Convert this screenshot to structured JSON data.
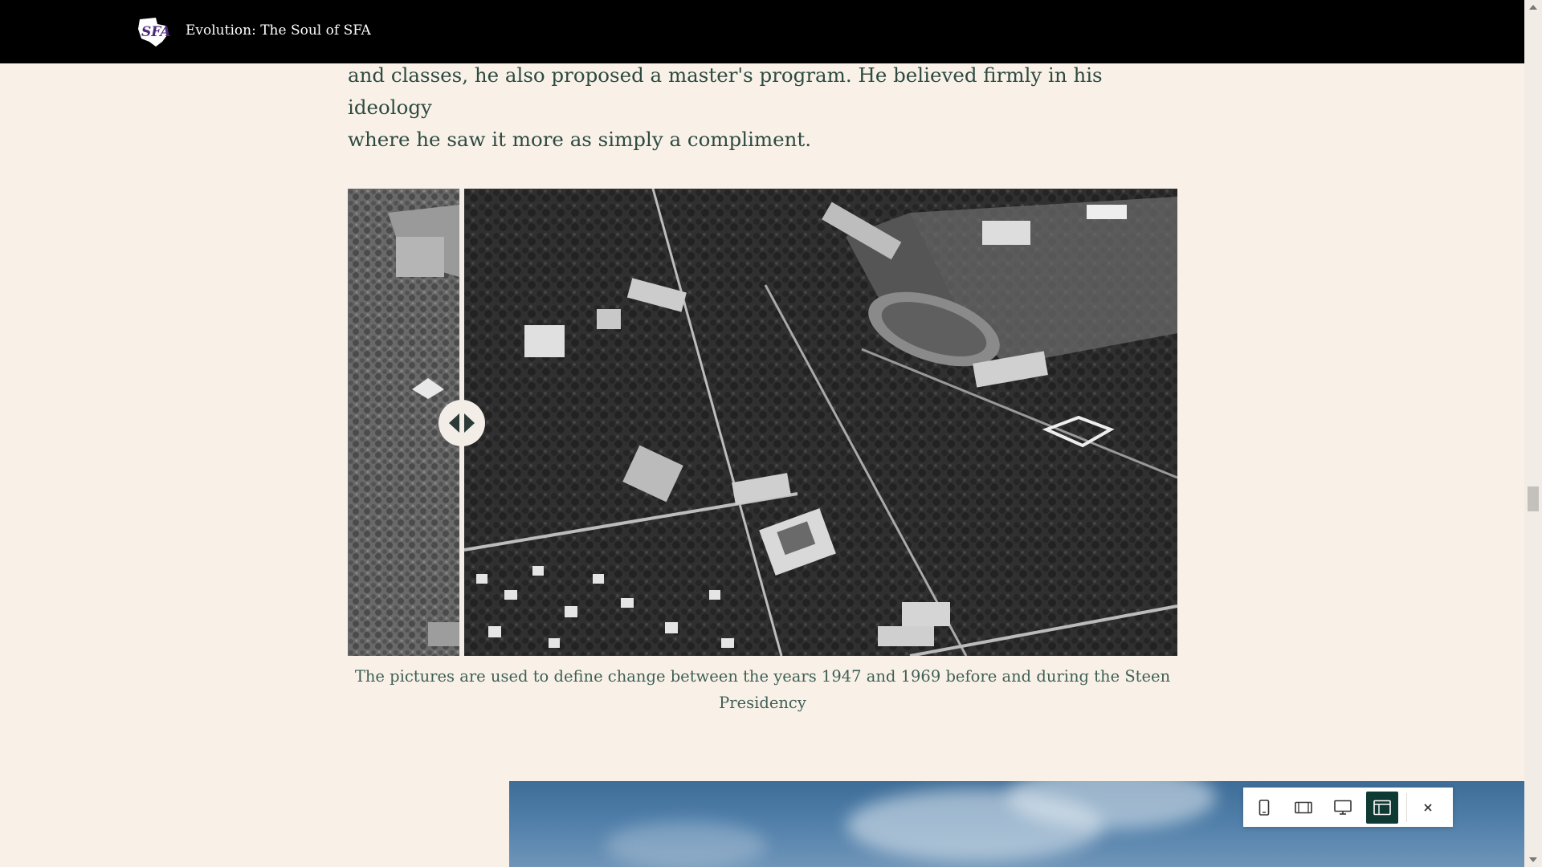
{
  "header": {
    "site_title": "Evolution: The Soul of SFA",
    "logo_text": "SFA"
  },
  "article": {
    "intro_line1": "and classes, he also proposed a master's program. He believed firmly in his ideology",
    "intro_line2": "where he saw it more as simply a compliment.",
    "caption": "The pictures are used to define change between the years 1947 and 1969 before and during the Steen Presidency"
  },
  "image_compare": {
    "handle_icon": "left-right-arrows-icon",
    "position": 0.14
  },
  "toolbar": {
    "buttons": [
      {
        "icon": "mobile-icon",
        "active": false
      },
      {
        "icon": "tablet-icon",
        "active": false
      },
      {
        "icon": "desktop-icon",
        "active": false
      },
      {
        "icon": "layout-icon",
        "active": true
      }
    ],
    "close_icon": "close-icon",
    "active_color": "#0f3a33"
  },
  "colors": {
    "background": "#f9f1e7",
    "text": "#2d4a42",
    "topbar": "#000000"
  }
}
